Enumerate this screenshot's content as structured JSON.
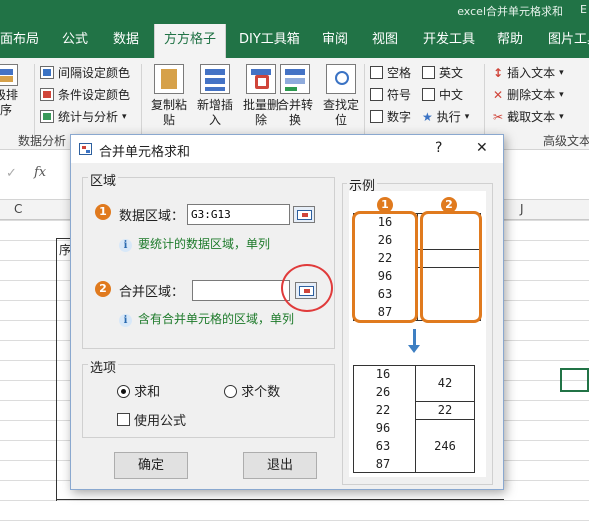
{
  "window": {
    "title": "excel合并单元格求和",
    "title_tail": "E"
  },
  "tabs": [
    {
      "label": "面布局"
    },
    {
      "label": "公式"
    },
    {
      "label": "数据"
    },
    {
      "label": "方方格子"
    },
    {
      "label": "DIY工具箱"
    },
    {
      "label": "审阅"
    },
    {
      "label": "视图"
    },
    {
      "label": "开发工具"
    },
    {
      "label": "帮助"
    },
    {
      "label": "图片工具"
    }
  ],
  "ribbon": {
    "left_partial": {
      "line1": "级排",
      "line2": "序"
    },
    "analysis": {
      "interval_color": "间隔设定颜色",
      "cond_color": "条件设定颜色",
      "stats": "统计与分析",
      "group_label": "数据分析"
    },
    "big_buttons": [
      {
        "line1": "复制粘",
        "line2": "贴"
      },
      {
        "line1": "新增插",
        "line2": "入"
      },
      {
        "line1": "批量删",
        "line2": "除"
      },
      {
        "line1": "合并转",
        "line2": "换"
      },
      {
        "line1": "查找定",
        "line2": "位"
      }
    ],
    "checks": [
      {
        "label": "空格"
      },
      {
        "label": "英文"
      },
      {
        "label": "符号"
      },
      {
        "label": "中文"
      },
      {
        "label": "数字"
      },
      {
        "label": "执行"
      }
    ],
    "text_ops": {
      "insert": "插入文本",
      "delete": "删除文本",
      "extract": "截取文本",
      "group_label": "高级文本"
    }
  },
  "formula_bar": {
    "fx": "fx"
  },
  "sheet": {
    "col_c": "C",
    "col_j": "J",
    "partial_cell": "序"
  },
  "dialog": {
    "title": "合并单元格求和",
    "help": "?",
    "close": "✕",
    "region": {
      "legend": "区域",
      "data_label": "数据区域：",
      "data_value": "G3:G13",
      "data_hint": "要统计的数据区域，单列",
      "merge_label": "合并区域：",
      "merge_value": "",
      "merge_hint": "含有合并单元格的区域，单列",
      "step1": "1",
      "step2": "2"
    },
    "options": {
      "legend": "选项",
      "sum": "求和",
      "count": "求个数",
      "use_formula": "使用公式",
      "selected": "sum"
    },
    "ok": "确定",
    "exit": "退出",
    "example": {
      "legend": "示例",
      "badge1": "1",
      "badge2": "2",
      "values": [
        "16",
        "26",
        "22",
        "96",
        "63",
        "87"
      ],
      "results": [
        "42",
        "22",
        "246"
      ]
    }
  },
  "colors": {
    "excel_green": "#217346",
    "accent_orange": "#e07a1e",
    "highlight_red": "#e03b3b",
    "arrow_blue": "#3e7fc2"
  }
}
